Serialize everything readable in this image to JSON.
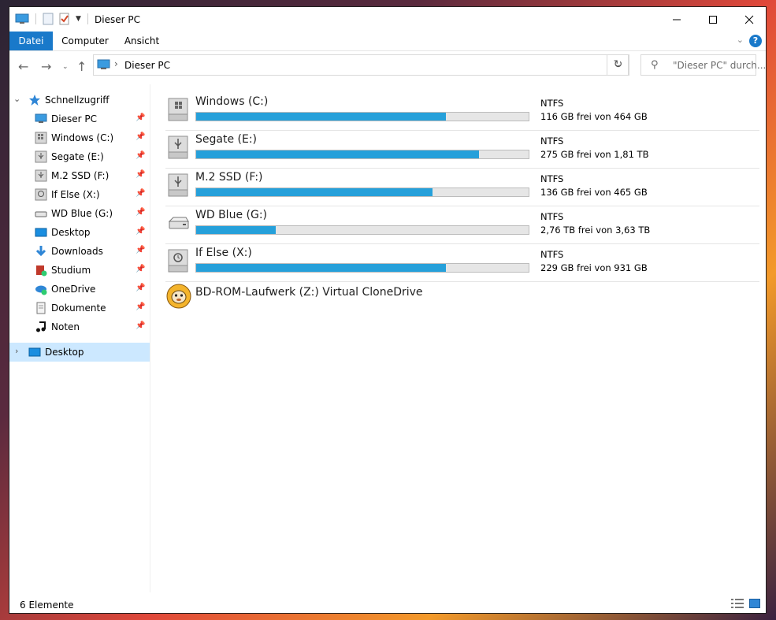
{
  "window": {
    "title": "Dieser PC"
  },
  "ribbon": {
    "tabs": [
      {
        "label": "Datei",
        "active": true
      },
      {
        "label": "Computer",
        "active": false
      },
      {
        "label": "Ansicht",
        "active": false
      }
    ],
    "help_label": "?"
  },
  "address": {
    "path": "Dieser PC"
  },
  "search": {
    "placeholder": "\"Dieser PC\" durch..."
  },
  "sidebar": {
    "quick_access": {
      "label": "Schnellzugriff"
    },
    "items": [
      {
        "label": "Dieser PC",
        "icon": "monitor-icon",
        "pinned": true
      },
      {
        "label": "Windows (C:)",
        "icon": "windows-drive-icon",
        "pinned": true
      },
      {
        "label": "Segate (E:)",
        "icon": "usb-drive-icon",
        "pinned": true
      },
      {
        "label": "M.2 SSD (F:)",
        "icon": "usb-drive-icon",
        "pinned": true
      },
      {
        "label": "If Else (X:)",
        "icon": "backup-drive-icon",
        "pinned": true
      },
      {
        "label": "WD Blue (G:)",
        "icon": "external-drive-icon",
        "pinned": true
      },
      {
        "label": "Desktop",
        "icon": "desktop-folder-icon",
        "pinned": true
      },
      {
        "label": "Downloads",
        "icon": "download-arrow-icon",
        "pinned": true
      },
      {
        "label": "Studium",
        "icon": "study-folder-icon",
        "pinned": true
      },
      {
        "label": "OneDrive",
        "icon": "cloud-icon",
        "pinned": true
      },
      {
        "label": "Dokumente",
        "icon": "document-icon",
        "pinned": true
      },
      {
        "label": "Noten",
        "icon": "music-note-icon",
        "pinned": true
      }
    ],
    "desktop_root": {
      "label": "Desktop"
    }
  },
  "drives": [
    {
      "name": "Windows (C:)",
      "fs": "NTFS",
      "free_text": "116 GB frei von 464 GB",
      "used_fraction": 0.75,
      "icon": "windows-drive-icon"
    },
    {
      "name": "Segate (E:)",
      "fs": "NTFS",
      "free_text": "275 GB frei von 1,81 TB",
      "used_fraction": 0.85,
      "icon": "usb-drive-icon"
    },
    {
      "name": "M.2 SSD (F:)",
      "fs": "NTFS",
      "free_text": "136 GB frei von 465 GB",
      "used_fraction": 0.71,
      "icon": "usb-drive-icon"
    },
    {
      "name": "WD Blue (G:)",
      "fs": "NTFS",
      "free_text": "2,76 TB frei von 3,63 TB",
      "used_fraction": 0.24,
      "icon": "external-drive-icon"
    },
    {
      "name": "If Else (X:)",
      "fs": "NTFS",
      "free_text": "229 GB frei von 931 GB",
      "used_fraction": 0.75,
      "icon": "backup-drive-icon"
    }
  ],
  "optical_drive": {
    "name": "BD-ROM-Laufwerk (Z:) Virtual CloneDrive",
    "icon": "sheep-clonedrive-icon"
  },
  "status": {
    "count_text": "6 Elemente"
  },
  "colors": {
    "accent": "#1979ca",
    "bar_fill": "#26a0da",
    "selection": "#cce8ff"
  }
}
